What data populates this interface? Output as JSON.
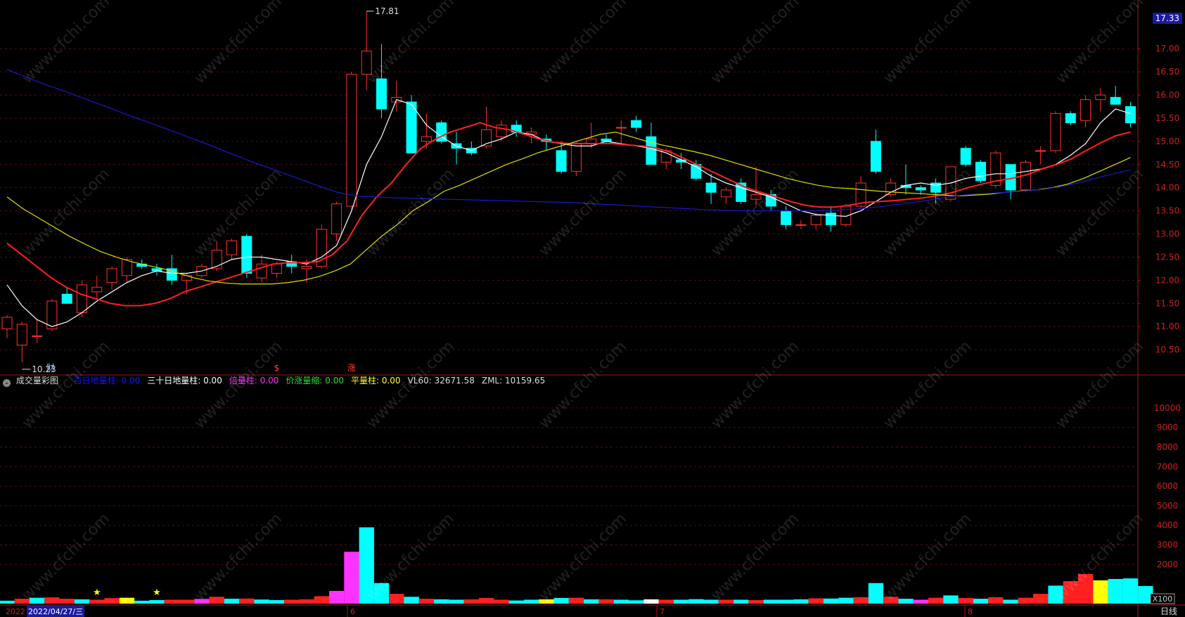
{
  "watermark": "www.cfchi.com",
  "price_panel": {
    "last_price": "17.33",
    "high_label": "17.81",
    "low_label": "10.23",
    "markers": [
      "财",
      "$",
      "涨"
    ]
  },
  "volume_panel": {
    "title": "成交量彩图",
    "indicators": [
      {
        "label": "百日地量柱:",
        "value": "0.00",
        "color": "#1515ff"
      },
      {
        "label": "三十日地量柱:",
        "value": "0.00",
        "color": "#ffffff"
      },
      {
        "label": "倍量柱:",
        "value": "0.00",
        "color": "#ff33ff"
      },
      {
        "label": "价涨量缩:",
        "value": "0.00",
        "color": "#33dd33"
      },
      {
        "label": "平量柱:",
        "value": "0.00",
        "color": "#ffff33"
      },
      {
        "label": "VL60:",
        "value": "32671.58",
        "color": "#dddddd"
      },
      {
        "label": "ZML:",
        "value": "10159.65",
        "color": "#dddddd"
      }
    ],
    "unit_label": "X100"
  },
  "time_axis": {
    "year_label": "2022",
    "current_date": "2022/04/27/三",
    "month_labels": [
      "6",
      "7",
      "8"
    ],
    "period_label": "日线"
  },
  "chart_data": [
    {
      "type": "candlestick",
      "ylim": [
        10.0,
        17.9
      ],
      "y_ticks": [
        "10.50",
        "11.00",
        "11.50",
        "12.00",
        "12.50",
        "13.00",
        "13.50",
        "14.00",
        "14.50",
        "15.00",
        "15.50",
        "16.00",
        "16.50",
        "17.00"
      ],
      "candles": [
        {
          "o": 10.95,
          "h": 11.25,
          "l": 10.75,
          "c": 11.2
        },
        {
          "o": 10.6,
          "h": 11.1,
          "l": 10.23,
          "c": 11.05
        },
        {
          "o": 10.8,
          "h": 11.15,
          "l": 10.65,
          "c": 10.8
        },
        {
          "o": 10.95,
          "h": 11.6,
          "l": 10.9,
          "c": 11.55
        },
        {
          "o": 11.7,
          "h": 11.85,
          "l": 11.5,
          "c": 11.5
        },
        {
          "o": 11.3,
          "h": 12.0,
          "l": 11.2,
          "c": 11.9
        },
        {
          "o": 11.75,
          "h": 12.1,
          "l": 11.6,
          "c": 11.85
        },
        {
          "o": 11.95,
          "h": 12.3,
          "l": 11.8,
          "c": 12.25
        },
        {
          "o": 12.1,
          "h": 12.5,
          "l": 11.95,
          "c": 12.45
        },
        {
          "o": 12.35,
          "h": 12.45,
          "l": 12.25,
          "c": 12.3
        },
        {
          "o": 12.25,
          "h": 12.35,
          "l": 12.1,
          "c": 12.2
        },
        {
          "o": 12.25,
          "h": 12.55,
          "l": 11.9,
          "c": 12.0
        },
        {
          "o": 12.0,
          "h": 12.15,
          "l": 11.7,
          "c": 12.1
        },
        {
          "o": 12.1,
          "h": 12.35,
          "l": 12.05,
          "c": 12.3
        },
        {
          "o": 12.25,
          "h": 12.85,
          "l": 12.2,
          "c": 12.65
        },
        {
          "o": 12.55,
          "h": 12.9,
          "l": 12.45,
          "c": 12.85
        },
        {
          "o": 12.95,
          "h": 13.0,
          "l": 12.05,
          "c": 12.15
        },
        {
          "o": 12.05,
          "h": 12.55,
          "l": 11.95,
          "c": 12.35
        },
        {
          "o": 12.15,
          "h": 12.4,
          "l": 12.05,
          "c": 12.35
        },
        {
          "o": 12.4,
          "h": 12.55,
          "l": 12.15,
          "c": 12.3
        },
        {
          "o": 12.25,
          "h": 12.45,
          "l": 11.95,
          "c": 12.3
        },
        {
          "o": 12.3,
          "h": 13.2,
          "l": 12.25,
          "c": 13.1
        },
        {
          "o": 13.0,
          "h": 13.7,
          "l": 12.85,
          "c": 13.65
        },
        {
          "o": 13.6,
          "h": 16.5,
          "l": 13.5,
          "c": 16.45
        },
        {
          "o": 16.45,
          "h": 17.81,
          "l": 16.1,
          "c": 16.95
        },
        {
          "o": 16.35,
          "h": 17.1,
          "l": 15.5,
          "c": 15.7
        },
        {
          "o": 15.85,
          "h": 16.3,
          "l": 15.65,
          "c": 15.95
        },
        {
          "o": 15.85,
          "h": 16.0,
          "l": 14.75,
          "c": 14.75
        },
        {
          "o": 15.0,
          "h": 15.6,
          "l": 14.85,
          "c": 15.1
        },
        {
          "o": 15.4,
          "h": 15.45,
          "l": 14.95,
          "c": 15.0
        },
        {
          "o": 14.95,
          "h": 15.2,
          "l": 14.5,
          "c": 14.85
        },
        {
          "o": 14.85,
          "h": 15.0,
          "l": 14.7,
          "c": 14.75
        },
        {
          "o": 14.9,
          "h": 15.75,
          "l": 14.85,
          "c": 15.25
        },
        {
          "o": 15.1,
          "h": 15.45,
          "l": 15.0,
          "c": 15.35
        },
        {
          "o": 15.35,
          "h": 15.45,
          "l": 15.1,
          "c": 15.2
        },
        {
          "o": 15.15,
          "h": 15.3,
          "l": 14.95,
          "c": 15.2
        },
        {
          "o": 15.05,
          "h": 15.15,
          "l": 14.8,
          "c": 15.0
        },
        {
          "o": 14.8,
          "h": 15.0,
          "l": 14.3,
          "c": 14.35
        },
        {
          "o": 14.35,
          "h": 15.0,
          "l": 14.25,
          "c": 14.95
        },
        {
          "o": 14.95,
          "h": 15.4,
          "l": 14.85,
          "c": 15.05
        },
        {
          "o": 15.05,
          "h": 15.15,
          "l": 14.95,
          "c": 15.0
        },
        {
          "o": 15.3,
          "h": 15.45,
          "l": 14.95,
          "c": 15.3
        },
        {
          "o": 15.45,
          "h": 15.55,
          "l": 15.2,
          "c": 15.3
        },
        {
          "o": 15.1,
          "h": 15.4,
          "l": 14.6,
          "c": 14.5
        },
        {
          "o": 14.55,
          "h": 14.85,
          "l": 14.4,
          "c": 14.8
        },
        {
          "o": 14.6,
          "h": 14.75,
          "l": 14.4,
          "c": 14.55
        },
        {
          "o": 14.5,
          "h": 14.6,
          "l": 14.15,
          "c": 14.2
        },
        {
          "o": 14.1,
          "h": 14.3,
          "l": 13.65,
          "c": 13.9
        },
        {
          "o": 13.8,
          "h": 14.0,
          "l": 13.65,
          "c": 13.95
        },
        {
          "o": 14.1,
          "h": 14.2,
          "l": 13.65,
          "c": 13.7
        },
        {
          "o": 13.75,
          "h": 14.45,
          "l": 13.6,
          "c": 13.85
        },
        {
          "o": 13.85,
          "h": 13.95,
          "l": 13.5,
          "c": 13.6
        },
        {
          "o": 13.5,
          "h": 13.6,
          "l": 13.1,
          "c": 13.2
        },
        {
          "o": 13.2,
          "h": 13.3,
          "l": 13.1,
          "c": 13.2
        },
        {
          "o": 13.2,
          "h": 13.45,
          "l": 13.1,
          "c": 13.4
        },
        {
          "o": 13.45,
          "h": 13.6,
          "l": 13.05,
          "c": 13.2
        },
        {
          "o": 13.2,
          "h": 13.65,
          "l": 13.15,
          "c": 13.6
        },
        {
          "o": 13.6,
          "h": 14.25,
          "l": 13.55,
          "c": 14.1
        },
        {
          "o": 15.0,
          "h": 15.25,
          "l": 14.3,
          "c": 14.35
        },
        {
          "o": 13.85,
          "h": 14.2,
          "l": 13.8,
          "c": 14.1
        },
        {
          "o": 14.05,
          "h": 14.5,
          "l": 13.85,
          "c": 14.0
        },
        {
          "o": 14.0,
          "h": 14.05,
          "l": 13.85,
          "c": 13.95
        },
        {
          "o": 14.1,
          "h": 14.2,
          "l": 13.65,
          "c": 13.9
        },
        {
          "o": 13.75,
          "h": 14.45,
          "l": 13.7,
          "c": 14.45
        },
        {
          "o": 14.85,
          "h": 14.9,
          "l": 14.45,
          "c": 14.5
        },
        {
          "o": 14.55,
          "h": 14.6,
          "l": 14.1,
          "c": 14.15
        },
        {
          "o": 14.05,
          "h": 14.8,
          "l": 14.0,
          "c": 14.75
        },
        {
          "o": 14.5,
          "h": 14.5,
          "l": 13.75,
          "c": 13.95
        },
        {
          "o": 13.95,
          "h": 14.6,
          "l": 13.9,
          "c": 14.55
        },
        {
          "o": 14.8,
          "h": 14.9,
          "l": 14.5,
          "c": 14.8
        },
        {
          "o": 14.8,
          "h": 15.65,
          "l": 14.75,
          "c": 15.6
        },
        {
          "o": 15.6,
          "h": 15.65,
          "l": 15.35,
          "c": 15.4
        },
        {
          "o": 15.45,
          "h": 16.0,
          "l": 15.3,
          "c": 15.9
        },
        {
          "o": 15.9,
          "h": 16.15,
          "l": 15.65,
          "c": 16.0
        },
        {
          "o": 15.95,
          "h": 16.2,
          "l": 15.8,
          "c": 15.8
        },
        {
          "o": 15.75,
          "h": 15.85,
          "l": 15.3,
          "c": 15.4
        }
      ],
      "moving_averages": [
        {
          "color": "#ffffff",
          "values": [
            11.9,
            11.45,
            11.15,
            11.0,
            11.1,
            11.3,
            11.55,
            11.75,
            11.95,
            12.1,
            12.2,
            12.15,
            12.15,
            12.2,
            12.3,
            12.45,
            12.5,
            12.5,
            12.45,
            12.4,
            12.35,
            12.5,
            12.75,
            13.5,
            14.5,
            15.1,
            15.9,
            15.8,
            15.35,
            15.1,
            14.9,
            14.8,
            14.95,
            15.05,
            15.2,
            15.15,
            15.0,
            14.95,
            14.9,
            14.9,
            15.0,
            14.95,
            14.9,
            14.85,
            14.75,
            14.6,
            14.45,
            14.25,
            14.1,
            14.0,
            13.9,
            13.8,
            13.65,
            13.5,
            13.42,
            13.4,
            13.38,
            13.5,
            13.7,
            13.9,
            14.05,
            14.1,
            14.05,
            14.1,
            14.2,
            14.25,
            14.3,
            14.3,
            14.35,
            14.4,
            14.5,
            14.7,
            14.95,
            15.4,
            15.7,
            15.6
          ]
        },
        {
          "color": "#ff2020",
          "values": [
            12.8,
            12.55,
            12.3,
            12.05,
            11.85,
            11.7,
            11.6,
            11.5,
            11.45,
            11.45,
            11.5,
            11.6,
            11.75,
            11.85,
            11.95,
            12.05,
            12.15,
            12.25,
            12.35,
            12.38,
            12.38,
            12.4,
            12.55,
            12.85,
            13.4,
            13.8,
            14.1,
            14.5,
            14.85,
            15.05,
            15.2,
            15.3,
            15.4,
            15.3,
            15.25,
            15.15,
            15.05,
            14.98,
            14.95,
            14.95,
            14.95,
            14.95,
            14.92,
            14.9,
            14.85,
            14.75,
            14.6,
            14.45,
            14.3,
            14.15,
            14.0,
            13.9,
            13.8,
            13.7,
            13.62,
            13.58,
            13.58,
            13.62,
            13.68,
            13.7,
            13.72,
            13.75,
            13.78,
            13.83,
            13.9,
            14.0,
            14.08,
            14.15,
            14.2,
            14.28,
            14.4,
            14.5,
            14.62,
            14.8,
            14.97,
            15.12,
            15.2
          ]
        },
        {
          "color": "#dddd00",
          "values": [
            13.8,
            13.55,
            13.35,
            13.15,
            12.95,
            12.78,
            12.62,
            12.5,
            12.4,
            12.32,
            12.25,
            12.15,
            12.05,
            11.98,
            11.94,
            11.92,
            11.92,
            11.92,
            11.95,
            12.0,
            12.08,
            12.2,
            12.35,
            12.65,
            12.95,
            13.2,
            13.5,
            13.7,
            13.92,
            14.05,
            14.2,
            14.35,
            14.5,
            14.62,
            14.75,
            14.85,
            14.95,
            15.05,
            15.15,
            15.2,
            15.1,
            15.0,
            14.92,
            14.85,
            14.78,
            14.7,
            14.6,
            14.5,
            14.4,
            14.3,
            14.2,
            14.12,
            14.05,
            14.0,
            13.98,
            13.95,
            13.92,
            13.9,
            13.88,
            13.86,
            13.84,
            13.82,
            13.84,
            13.86,
            13.9,
            13.93,
            13.95,
            14.0,
            14.08,
            14.2,
            14.35,
            14.5,
            14.65
          ]
        },
        {
          "color": "#1a1ac8",
          "values": [
            16.55,
            16.4,
            16.25,
            16.12,
            15.98,
            15.84,
            15.7,
            15.55,
            15.42,
            15.28,
            15.14,
            15.0,
            14.85,
            14.7,
            14.55,
            14.42,
            14.28,
            14.14,
            14.0,
            13.88,
            13.82,
            13.8,
            13.78,
            13.77,
            13.76,
            13.75,
            13.74,
            13.73,
            13.72,
            13.71,
            13.7,
            13.69,
            13.68,
            13.66,
            13.64,
            13.62,
            13.6,
            13.58,
            13.56,
            13.54,
            13.52,
            13.51,
            13.5,
            13.5,
            13.5,
            13.5,
            13.5,
            13.51,
            13.53,
            13.56,
            13.6,
            13.65,
            13.7,
            13.76,
            13.82,
            13.86,
            13.88,
            13.9,
            13.93,
            13.96,
            14.02,
            14.1,
            14.2,
            14.3,
            14.38
          ]
        }
      ]
    },
    {
      "type": "bar",
      "ylabel": "",
      "ylim": [
        0,
        11000
      ],
      "y_ticks": [
        "2000",
        "3000",
        "4000",
        "5000",
        "6000",
        "7000",
        "8000",
        "9000",
        "10000"
      ],
      "values": [
        150,
        250,
        300,
        320,
        250,
        220,
        200,
        280,
        300,
        150,
        180,
        200,
        200,
        240,
        350,
        250,
        260,
        210,
        180,
        200,
        220,
        380,
        650,
        2650,
        3900,
        1050,
        500,
        350,
        250,
        220,
        200,
        220,
        290,
        200,
        160,
        200,
        220,
        290,
        300,
        220,
        220,
        200,
        170,
        220,
        200,
        200,
        230,
        200,
        200,
        200,
        180,
        200,
        200,
        220,
        270,
        260,
        300,
        330,
        1050,
        350,
        250,
        200,
        300,
        420,
        290,
        250,
        330,
        200,
        300,
        500,
        920,
        1150,
        1510,
        1190,
        1260,
        1290,
        900
      ],
      "colors": [
        "#00ffff",
        "#ff2020",
        "#00ffff",
        "#ff2020",
        "#ff2020",
        "#00ffff",
        "#ff2020",
        "#ff2020",
        "#ffff00",
        "#00ffff",
        "#00ffff",
        "#ff2020",
        "#ff2020",
        "#ff33ff",
        "#ff2020",
        "#00ffff",
        "#ff2020",
        "#00ffff",
        "#00ffff",
        "#ff2020",
        "#ff2020",
        "#ff2020",
        "#ff33ff",
        "#ff33ff",
        "#00ffff",
        "#00ffff",
        "#ff2020",
        "#00ffff",
        "#ff2020",
        "#00ffff",
        "#00ffff",
        "#ff2020",
        "#ff2020",
        "#ff2020",
        "#00ffff",
        "#00ffff",
        "#ffff00",
        "#00ffff",
        "#ff2020",
        "#00ffff",
        "#ff2020",
        "#00ffff",
        "#00ffff",
        "#ffffff",
        "#ff2020",
        "#00ffff",
        "#00ffff",
        "#00ffff",
        "#ff2020",
        "#00ffff",
        "#ff2020",
        "#00ffff",
        "#00ffff",
        "#00ffff",
        "#ff2020",
        "#00ffff",
        "#00ffff",
        "#ff2020",
        "#00ffff",
        "#ff2020",
        "#00ffff",
        "#ff33ff",
        "#ff2020",
        "#00ffff",
        "#ff2020",
        "#00ffff",
        "#ff2020",
        "#00ffff",
        "#ff2020",
        "#ff2020",
        "#00ffff",
        "#ff2020",
        "#ff2020",
        "#ffff00",
        "#00ffff",
        "#00ffff"
      ],
      "star_markers": [
        "★",
        "★"
      ]
    }
  ]
}
